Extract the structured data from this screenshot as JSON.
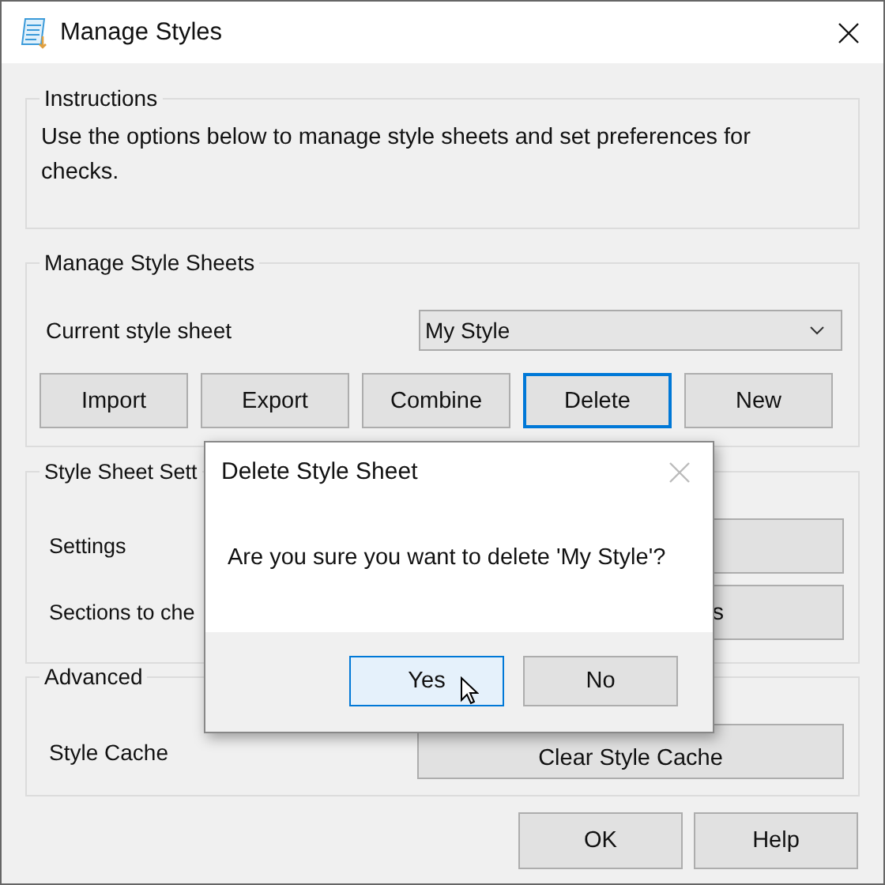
{
  "window": {
    "title": "Manage Styles"
  },
  "instructions": {
    "legend": "Instructions",
    "text": "Use the options below to manage style sheets and set preferences for checks."
  },
  "style_sheets": {
    "legend": "Manage Style Sheets",
    "current_label": "Current style sheet",
    "current_value": "My Style",
    "buttons": [
      {
        "label": "Import",
        "selected": false
      },
      {
        "label": "Export",
        "selected": false
      },
      {
        "label": "Combine",
        "selected": false
      },
      {
        "label": "Delete",
        "selected": true
      },
      {
        "label": "New",
        "selected": false
      }
    ]
  },
  "settings": {
    "legend": "Style Sheet Sett",
    "rows": [
      {
        "label": "Settings"
      },
      {
        "label": "Sections to che",
        "button": "s"
      }
    ]
  },
  "advanced": {
    "legend": "Advanced",
    "label": "Style Cache",
    "button": "Clear Style Cache"
  },
  "buttons": [
    "OK",
    "Help"
  ],
  "dialog": {
    "title": "Delete Style Sheet",
    "message": "Are you sure you want to delete 'My Style'?",
    "buttons": [
      {
        "label": "Yes",
        "selected": true
      },
      {
        "label": "No",
        "selected": false
      }
    ]
  }
}
